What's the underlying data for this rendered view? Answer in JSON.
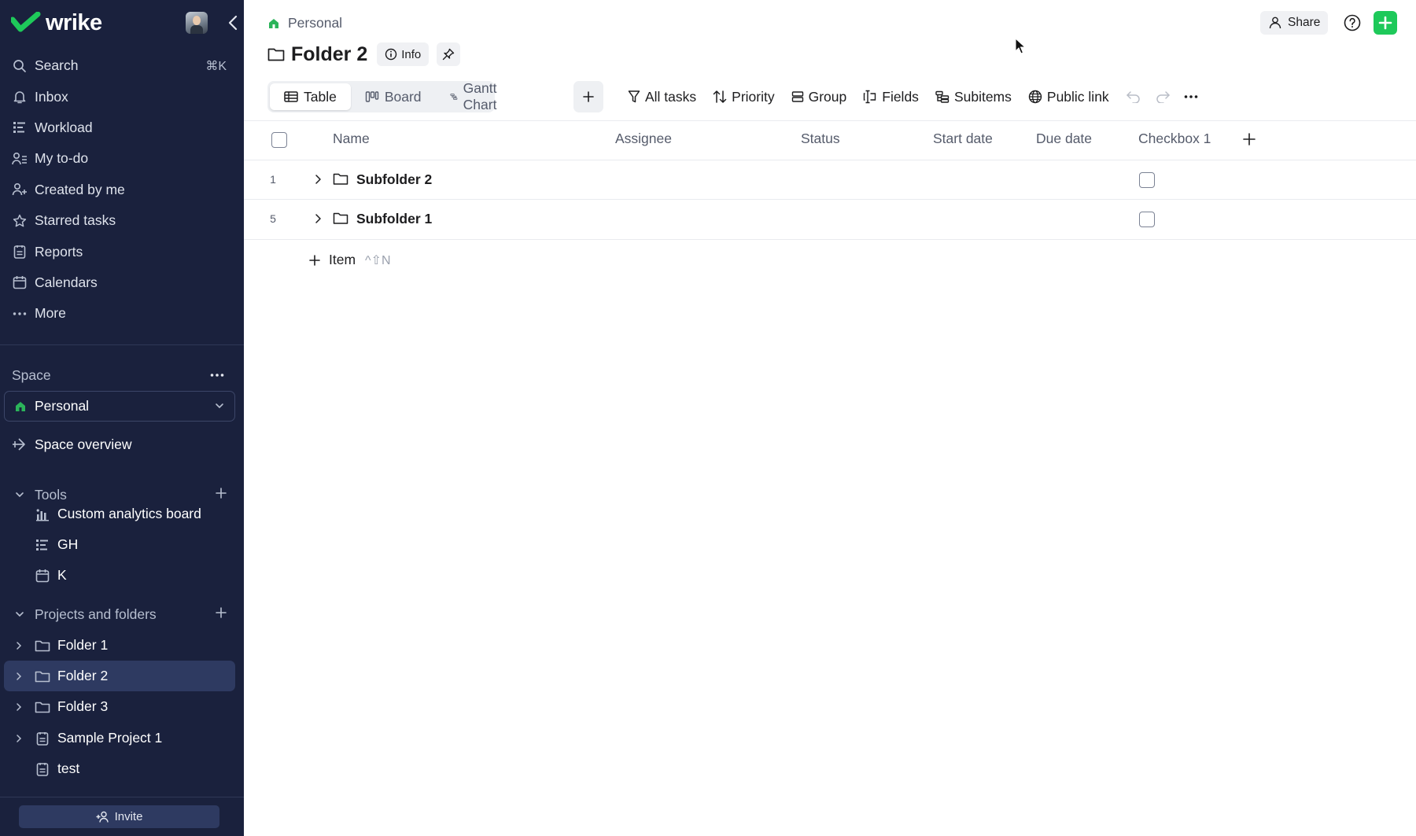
{
  "sidebar": {
    "logo": "wrike",
    "nav": [
      {
        "label": "Search",
        "icon": "search-icon",
        "shortcut": "⌘K"
      },
      {
        "label": "Inbox",
        "icon": "bell-icon"
      },
      {
        "label": "Workload",
        "icon": "workload-icon"
      },
      {
        "label": "My to-do",
        "icon": "user-list-icon"
      },
      {
        "label": "Created by me",
        "icon": "user-plus-icon"
      },
      {
        "label": "Starred tasks",
        "icon": "star-icon"
      },
      {
        "label": "Reports",
        "icon": "report-icon"
      },
      {
        "label": "Calendars",
        "icon": "calendar-icon"
      },
      {
        "label": "More",
        "icon": "more-dots-icon"
      }
    ],
    "space": {
      "label": "Space",
      "selected": "Personal"
    },
    "space_overview": "Space overview",
    "tools": {
      "label": "Tools",
      "items": [
        {
          "label": "Custom analytics board",
          "icon": "analytics-icon"
        },
        {
          "label": "GH",
          "icon": "workload-icon"
        },
        {
          "label": "K",
          "icon": "calendar-icon"
        }
      ]
    },
    "projects": {
      "label": "Projects and folders",
      "items": [
        {
          "label": "Folder 1",
          "icon": "folder-icon",
          "expandable": true
        },
        {
          "label": "Folder 2",
          "icon": "folder-icon",
          "expandable": true,
          "active": true
        },
        {
          "label": "Folder 3",
          "icon": "folder-icon",
          "expandable": true
        },
        {
          "label": "Sample Project 1",
          "icon": "project-icon",
          "expandable": true
        },
        {
          "label": "test",
          "icon": "project-icon",
          "expandable": false
        }
      ]
    },
    "invite": "Invite"
  },
  "header": {
    "breadcrumb": "Personal",
    "title": "Folder 2",
    "info": "Info",
    "share": "Share"
  },
  "views": {
    "tabs": [
      {
        "label": "Table",
        "icon": "table-icon",
        "active": true
      },
      {
        "label": "Board",
        "icon": "board-icon"
      },
      {
        "label": "Gantt Chart",
        "icon": "gantt-icon"
      }
    ]
  },
  "toolbar": {
    "all_tasks": "All tasks",
    "priority": "Priority",
    "group": "Group",
    "fields": "Fields",
    "subitems": "Subitems",
    "public_link": "Public link"
  },
  "table": {
    "columns": [
      "Name",
      "Assignee",
      "Status",
      "Start date",
      "Due date",
      "Checkbox 1"
    ],
    "rows": [
      {
        "num": "1",
        "name": "Subfolder 2",
        "checked": false
      },
      {
        "num": "5",
        "name": "Subfolder 1",
        "checked": false
      }
    ],
    "add_item": "Item",
    "add_item_shortcut": "^⇧N"
  },
  "colors": {
    "sidebar_bg": "#1a213d",
    "sidebar_active": "#2e3a61",
    "brand_green": "#1ec95a",
    "home_green": "#2bb45a"
  }
}
